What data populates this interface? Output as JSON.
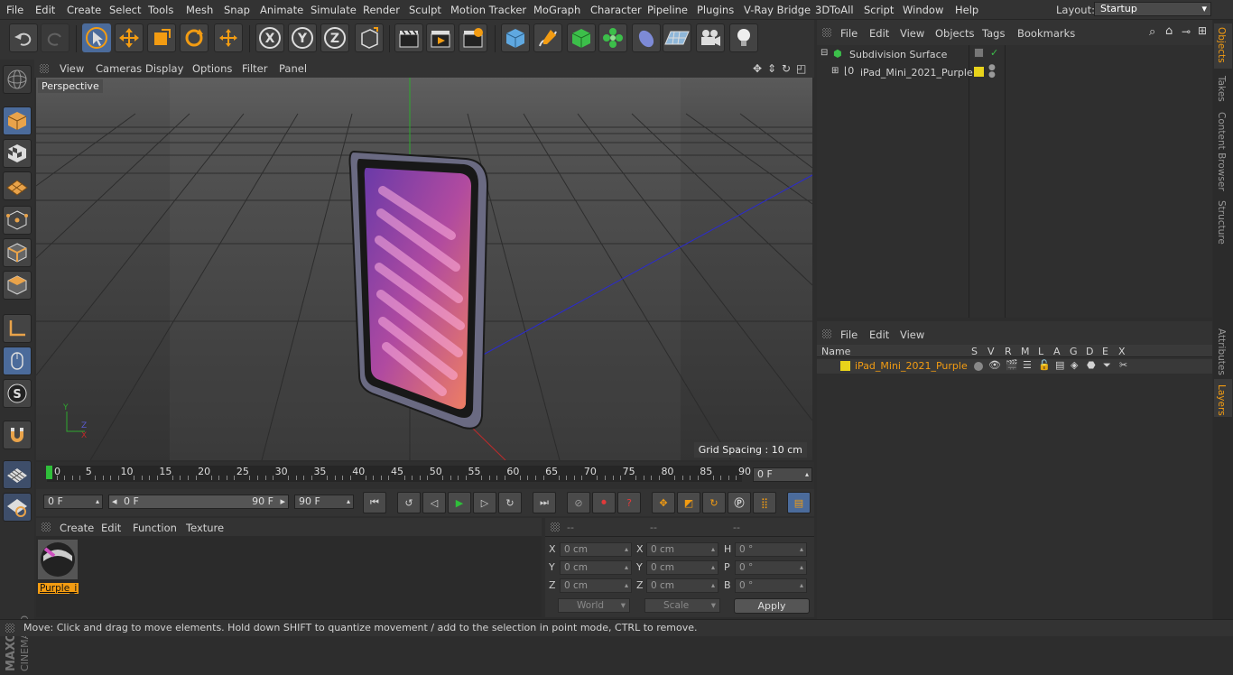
{
  "menubar": {
    "items": [
      "File",
      "Edit",
      "Create",
      "Select",
      "Tools",
      "Mesh",
      "Snap",
      "Animate",
      "Simulate",
      "Render",
      "Sculpt",
      "Motion Tracker",
      "MoGraph",
      "Character",
      "Pipeline",
      "Plugins",
      "V-Ray Bridge",
      "3DToAll",
      "Script",
      "Window",
      "Help"
    ],
    "layout_label": "Layout:",
    "layout_value": "Startup"
  },
  "viewport": {
    "menu": [
      "View",
      "Cameras",
      "Display",
      "Options",
      "Filter",
      "Panel"
    ],
    "label": "Perspective",
    "grid_spacing": "Grid Spacing : 10 cm"
  },
  "timeline": {
    "ticks": [
      "0",
      "5",
      "10",
      "15",
      "20",
      "25",
      "30",
      "35",
      "40",
      "45",
      "50",
      "55",
      "60",
      "65",
      "70",
      "75",
      "80",
      "85",
      "90"
    ],
    "current_frame": "0 F"
  },
  "transport": {
    "start_field": "0 F",
    "range_start": "0 F",
    "range_end": "90 F",
    "end_field": "90 F"
  },
  "material_panel": {
    "menu": [
      "Create",
      "Edit",
      "Function",
      "Texture"
    ],
    "material_name": "Purple_i"
  },
  "coords": {
    "headers": [
      "--",
      "--",
      "--"
    ],
    "rows": [
      {
        "l1": "X",
        "v1": "0 cm",
        "l2": "X",
        "v2": "0 cm",
        "l3": "H",
        "v3": "0 °"
      },
      {
        "l1": "Y",
        "v1": "0 cm",
        "l2": "Y",
        "v2": "0 cm",
        "l3": "P",
        "v3": "0 °"
      },
      {
        "l1": "Z",
        "v1": "0 cm",
        "l2": "Z",
        "v2": "0 cm",
        "l3": "B",
        "v3": "0 °"
      }
    ],
    "world": "World",
    "scale": "Scale",
    "apply": "Apply"
  },
  "object_manager": {
    "menu": [
      "File",
      "Edit",
      "View",
      "Objects",
      "Tags",
      "Bookmarks"
    ],
    "objects": [
      "Subdivision Surface",
      "iPad_Mini_2021_Purple"
    ]
  },
  "layer_manager": {
    "menu": [
      "File",
      "Edit",
      "View"
    ],
    "columns": [
      "Name",
      "S",
      "V",
      "R",
      "M",
      "L",
      "A",
      "G",
      "D",
      "E",
      "X"
    ],
    "layer_name": "iPad_Mini_2021_Purple"
  },
  "right_tabs": [
    "Objects",
    "Takes",
    "Content Browser",
    "Structure",
    "Attributes",
    "Layers"
  ],
  "status": "Move: Click and drag to move elements. Hold down SHIFT to quantize movement / add to the selection in point mode, CTRL to remove.",
  "colors": {
    "accent": "#f39c12",
    "layer": "#e8d31b",
    "selection": "#4b6b9b"
  }
}
